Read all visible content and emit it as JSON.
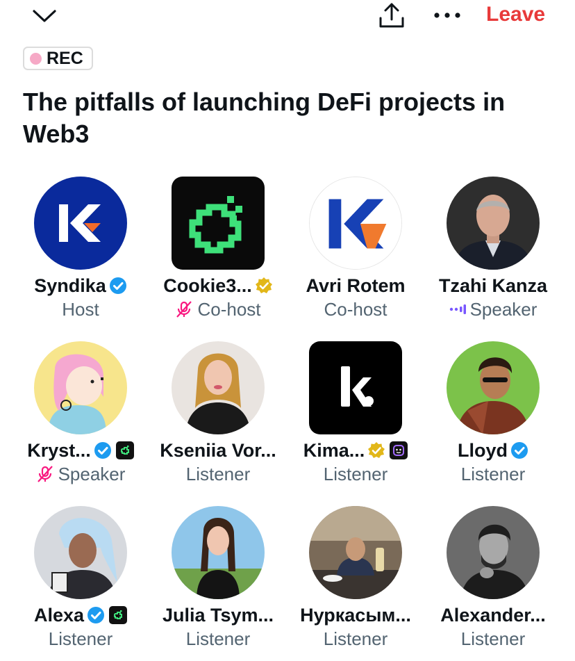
{
  "topbar": {
    "collapse_icon": "chevron-down-icon",
    "share_icon": "share-icon",
    "more_icon": "more-icon",
    "leave_label": "Leave"
  },
  "rec": {
    "label": "REC",
    "dot_color": "#f6a9c6"
  },
  "space": {
    "title": "The pitfalls of launching DeFi projects in Web3"
  },
  "colors": {
    "leave": "#e83a3a",
    "verified_blue": "#1d9bf0",
    "verified_gold": "#e2b719",
    "speaking": "#7856ff",
    "muted": "#f91880"
  },
  "participants": [
    {
      "name": "Syndika",
      "role": "Host",
      "verified": "blue",
      "role_icon": ""
    },
    {
      "name": "Cookie3...",
      "role": "Co-host",
      "verified": "gold",
      "role_icon": "mic-off-icon"
    },
    {
      "name": "Avri Rotem",
      "role": "Co-host",
      "verified": "",
      "role_icon": ""
    },
    {
      "name": "Tzahi Kanza",
      "role": "Speaker",
      "verified": "",
      "role_icon": "speaking-bars-icon"
    },
    {
      "name": "Kryst...",
      "role": "Speaker",
      "verified": "blue",
      "role_icon": "mic-off-icon"
    },
    {
      "name": "Kseniia Vor...",
      "role": "Listener",
      "verified": "",
      "role_icon": ""
    },
    {
      "name": "Kima...",
      "role": "Listener",
      "verified": "gold",
      "role_icon": ""
    },
    {
      "name": "Lloyd",
      "role": "Listener",
      "verified": "blue",
      "role_icon": ""
    },
    {
      "name": "Alexa",
      "role": "Listener",
      "verified": "blue",
      "role_icon": ""
    },
    {
      "name": "Julia Tsym...",
      "role": "Listener",
      "verified": "",
      "role_icon": ""
    },
    {
      "name": "Нуркасым...",
      "role": "Listener",
      "verified": "",
      "role_icon": ""
    },
    {
      "name": "Alexander...",
      "role": "Listener",
      "verified": "",
      "role_icon": ""
    }
  ]
}
